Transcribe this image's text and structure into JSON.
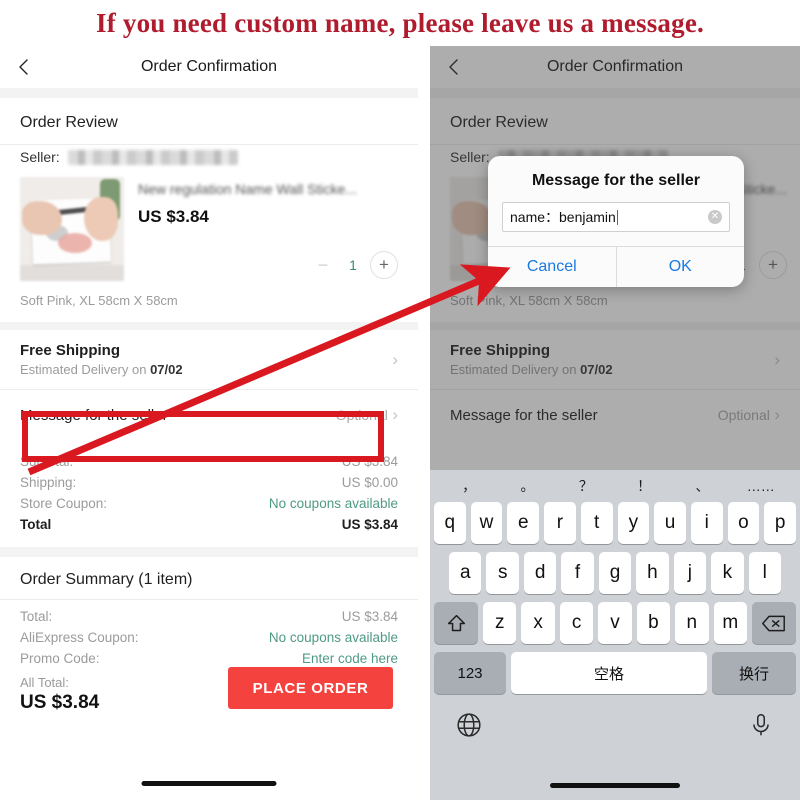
{
  "banner": {
    "text": "If you need custom name, please leave us a message."
  },
  "nav": {
    "title": "Order Confirmation",
    "back_icon": "chevron-left-icon"
  },
  "order_review": {
    "section_title": "Order Review",
    "seller_label": "Seller:",
    "seller_name_redacted": "",
    "product": {
      "name": "New regulation Name Wall Sticke...",
      "price": "US $3.84",
      "variant": "Soft Pink, XL 58cm X 58cm",
      "quantity": "1",
      "minus_icon": "minus-icon",
      "plus_icon": "plus-icon"
    }
  },
  "shipping": {
    "title": "Free Shipping",
    "eta_prefix": "Estimated Delivery on ",
    "eta_date": "07/02",
    "chevron": "›"
  },
  "message_row": {
    "label": "Message for the seller",
    "value": "Optional",
    "chevron": "›"
  },
  "totals": {
    "rows": [
      {
        "label": "Subtotal:",
        "value": "US $3.84",
        "accent": false
      },
      {
        "label": "Shipping:",
        "value": "US $0.00",
        "accent": false
      },
      {
        "label": "Store Coupon:",
        "value": "No coupons available",
        "accent": true
      }
    ],
    "total_label": "Total",
    "total_value": "US $3.84"
  },
  "summary": {
    "title": "Order Summary (1 item)",
    "rows": [
      {
        "label": "Total:",
        "value": "US $3.84",
        "accent": false
      },
      {
        "label": "AliExpress Coupon:",
        "value": "No coupons available",
        "accent": true
      },
      {
        "label": "Promo Code:",
        "value": "Enter code here",
        "accent": true
      }
    ],
    "all_total_label": "All Total:",
    "all_total_value": "US $3.84",
    "place_order_label": "PLACE ORDER"
  },
  "dialog": {
    "title": "Message for the seller",
    "input_value": "name：benjamin",
    "clear_icon": "clear-circle-icon",
    "cancel_label": "Cancel",
    "ok_label": "OK"
  },
  "keyboard": {
    "suggestions": [
      "，",
      "。",
      "？",
      "！",
      "、",
      "……"
    ],
    "row1": [
      "q",
      "w",
      "e",
      "r",
      "t",
      "y",
      "u",
      "i",
      "o",
      "p"
    ],
    "row2": [
      "a",
      "s",
      "d",
      "f",
      "g",
      "h",
      "j",
      "k",
      "l"
    ],
    "row3": [
      "z",
      "x",
      "c",
      "v",
      "b",
      "n",
      "m"
    ],
    "shift_icon": "shift-up-icon",
    "backspace_icon": "backspace-icon",
    "numbers_label": "123",
    "space_label": "空格",
    "return_label": "换行",
    "globe_icon": "globe-icon",
    "mic_icon": "microphone-icon"
  },
  "colors": {
    "banner_red": "#b01c2e",
    "annotation_red": "#d9181f",
    "place_order": "#f4433f",
    "teal_link": "#4f9a85",
    "dialog_blue": "#1a7ae0"
  }
}
